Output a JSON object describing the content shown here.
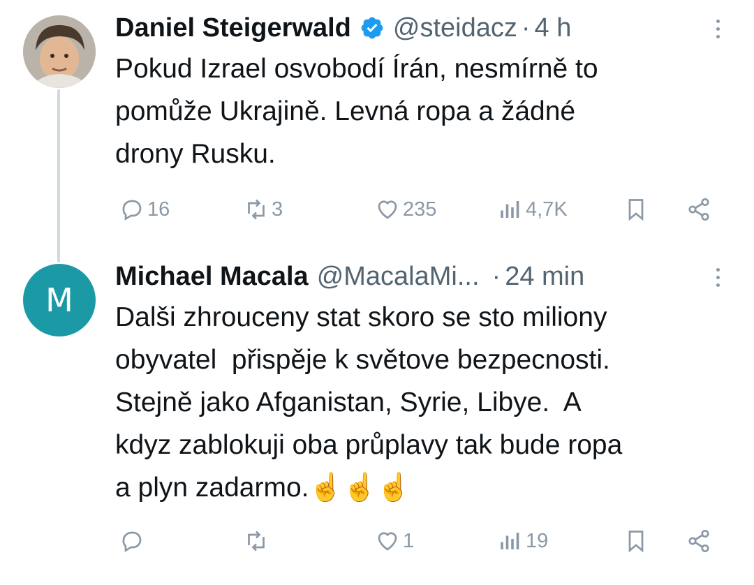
{
  "tweets": [
    {
      "author": "Daniel Steigerwald",
      "verified": true,
      "handle": "@steidacz",
      "separator": "·",
      "time": "4 h",
      "text": "Pokud Izrael osvobodí Írán, nesmírně to\npomůže Ukrajině. Levná ropa a žádné\ndrony Rusku.",
      "stats": {
        "replies": "16",
        "retweets": "3",
        "likes": "235",
        "views": "4,7K"
      }
    },
    {
      "author": "Michael Macala",
      "avatar_letter": "M",
      "handle": "@MacalaMi...",
      "separator": "·",
      "time": "24 min",
      "text": "Dalši zhrouceny stat skoro se sto miliony\nobyvatel  přispěje k světove bezpecnosti.\nStejně jako Afganistan, Syrie, Libye.  A\nkdyz zablokuji oba průplavy tak bude ropa\na plyn zadarmo.☝️☝️☝️",
      "stats": {
        "replies": "",
        "retweets": "",
        "likes": "1",
        "views": "19"
      }
    }
  ],
  "colors": {
    "verified": "#1d9bf0",
    "muted": "#536471",
    "icon": "#8b98a5",
    "avatar_m": "#1b9aa6",
    "thread_line": "#cfd9de"
  }
}
